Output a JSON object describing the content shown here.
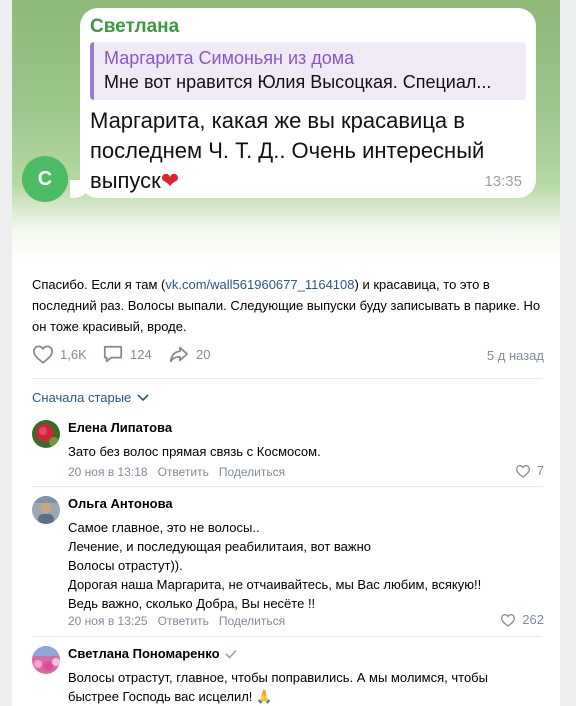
{
  "telegram": {
    "sender": "Светлана",
    "quote_author": "Маргарита Симоньян из дома",
    "quote_text": "Мне вот нравится Юлия Высоцкая. Специал...",
    "message": "Маргарита, какая же вы красавица в последнем Ч. Т. Д.. Очень интересный выпуск",
    "time": "13:35",
    "avatar_letter": "С"
  },
  "post": {
    "text_before": "Спасибо. Если я там (",
    "link": "vk.com/wall561960677_1164108",
    "text_after": ") и красавица, то это в последний раз. Волосы выпали. Следующие выпуски буду записывать в парике. Но он тоже красивый, вроде.",
    "likes": "1,6K",
    "comments": "124",
    "shares": "20",
    "date": "5 д назад"
  },
  "sort_label": "Сначала старые",
  "reply_label": "Ответить",
  "share_label": "Поделиться",
  "comments": [
    {
      "author": "Елена Липатова",
      "text": "Зато без волос прямая связь с Космосом.",
      "date": "20 ноя в 13:18",
      "likes": "7"
    },
    {
      "author": "Ольга Антонова",
      "lines": [
        "Самое главное, это не волосы..",
        "Лечение, и последующая реабилитаия, вот важно",
        "Волосы отрастут)).",
        "Дорогая наша Маргарита, не отчаивайтесь, мы Вас любим, всякую!!",
        "Ведь важно, сколько Добра, Вы несёте !!"
      ],
      "date": "20 ноя в 13:25",
      "likes": "262"
    },
    {
      "author": "Светлана Пономаренко",
      "text": "Волосы отрастут, главное, чтобы поправились. А мы молимся, чтобы быстрее Господь вас исцелил!",
      "emoji": "🙏"
    }
  ],
  "colors": {
    "link": "#2a5885",
    "muted": "#818c99",
    "tg_green": "#3a9a3f",
    "tg_quote": "#8b55c8",
    "heart": "#e0202e"
  }
}
